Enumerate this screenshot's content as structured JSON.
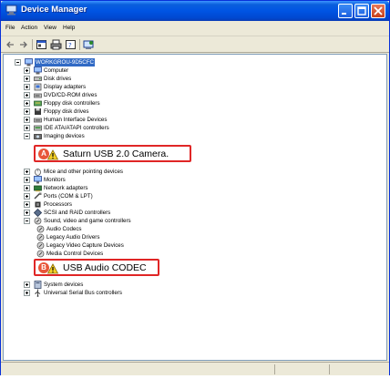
{
  "window": {
    "title": "Device Manager",
    "accent": "#0054e3"
  },
  "menu": {
    "items": [
      "File",
      "Action",
      "View",
      "Help"
    ]
  },
  "tree": {
    "root": "WORKGROU-9D5CFC",
    "categories": [
      "Computer",
      "Disk drives",
      "Display adapters",
      "DVD/CD-ROM drives",
      "Floppy disk controllers",
      "Floppy disk drives",
      "Human Interface Devices",
      "IDE ATA/ATAPI controllers",
      "Imaging devices"
    ],
    "categories_after_camera": [
      "Mice and other pointing devices",
      "Monitors",
      "Network adapters",
      "Ports (COM & LPT)",
      "Processors",
      "SCSI and RAID controllers",
      "Sound, video and game controllers"
    ],
    "sound_children": [
      "Audio Codecs",
      "Legacy Audio Drivers",
      "Legacy Video Capture Devices",
      "Media Control Devices"
    ],
    "tail_categories": [
      "System devices",
      "Universal Serial Bus controllers"
    ]
  },
  "callouts": {
    "camera": {
      "badge": "A",
      "label": "Saturn USB 2.0 Camera."
    },
    "audio": {
      "badge": "B",
      "label": "USB Audio CODEC"
    }
  },
  "colors": {
    "callout_border": "#e02626",
    "badge": "#e8563a",
    "selection": "#316ac5"
  }
}
